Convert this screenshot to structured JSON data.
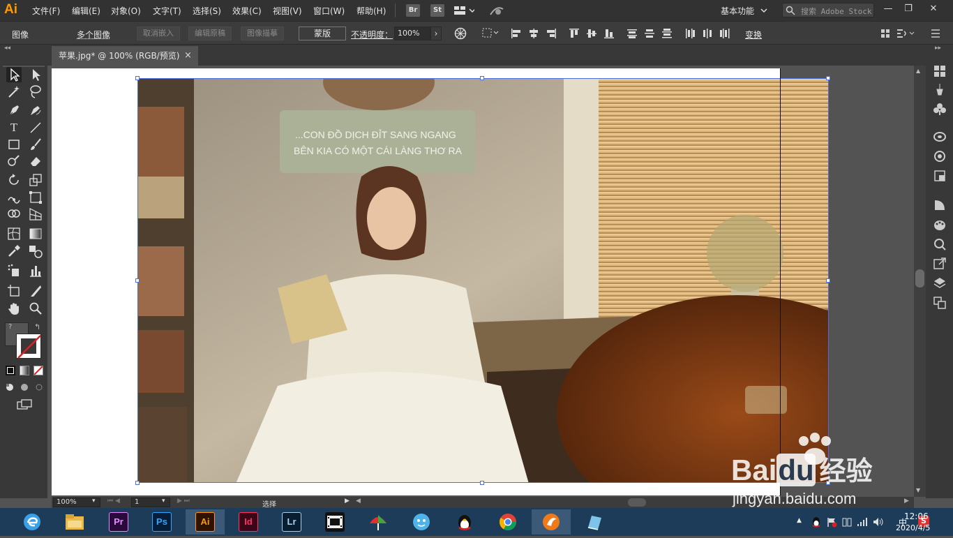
{
  "app": {
    "logo": "Ai",
    "colors": {
      "accent": "#ff9a00",
      "selection": "#4b6fd6"
    }
  },
  "menu": {
    "items": [
      "文件(F)",
      "编辑(E)",
      "对象(O)",
      "文字(T)",
      "选择(S)",
      "效果(C)",
      "视图(V)",
      "窗口(W)",
      "帮助(H)"
    ],
    "bridge": "Br",
    "stock_btn": "St",
    "workspace": "基本功能",
    "search_placeholder": "搜索 Adobe Stock"
  },
  "control_bar": {
    "object_type": "图像",
    "multi_image": "多个图像",
    "cancel_embed": "取消嵌入",
    "edit_original": "编辑原稿",
    "image_trace": "图像描摹",
    "mask": "蒙版",
    "opacity_label": "不透明度：",
    "opacity_value": "100%",
    "transform": "变换"
  },
  "document": {
    "tab_title": "苹果.jpg* @ 100% (RGB/预览)",
    "close": "×"
  },
  "statusbar": {
    "zoom": "100%",
    "page": "1",
    "tool_name": "选择"
  },
  "taskbar": {
    "apps": [
      {
        "name": "edge",
        "label": "e"
      },
      {
        "name": "explorer",
        "label": ""
      },
      {
        "name": "premiere",
        "label": "Pr"
      },
      {
        "name": "photoshop",
        "label": "Ps"
      },
      {
        "name": "illustrator",
        "label": "Ai"
      },
      {
        "name": "indesign",
        "label": "Id"
      },
      {
        "name": "lightroom",
        "label": "Lr"
      },
      {
        "name": "media",
        "label": ""
      },
      {
        "name": "umbrella",
        "label": ""
      },
      {
        "name": "chat",
        "label": ""
      },
      {
        "name": "qq",
        "label": ""
      },
      {
        "name": "chrome",
        "label": ""
      },
      {
        "name": "player",
        "label": ""
      },
      {
        "name": "notes",
        "label": ""
      }
    ],
    "time": "12:06",
    "date": "2020/4/5",
    "ime": "中"
  },
  "watermark": {
    "brand": "Bai",
    "brand2": "du",
    "cn": "经验",
    "url": "jingyan.baidu.com"
  }
}
